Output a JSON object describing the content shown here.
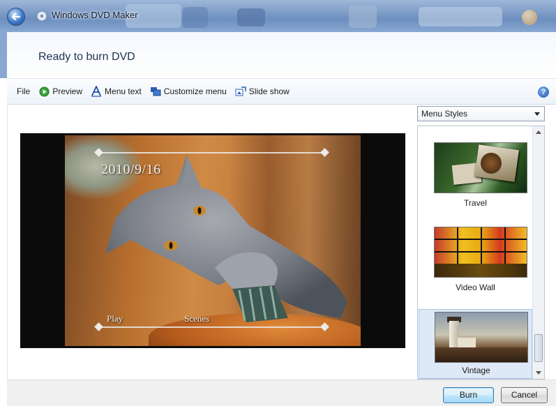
{
  "window": {
    "title": "Windows DVD Maker",
    "back_icon": "back-arrow-icon",
    "app_icon": "dvd-maker-icon"
  },
  "header": {
    "title": "Ready to burn DVD"
  },
  "toolbar": {
    "items": [
      {
        "label": "File",
        "icon": ""
      },
      {
        "label": "Preview",
        "icon": "play-icon"
      },
      {
        "label": "Menu text",
        "icon": "text-a-icon"
      },
      {
        "label": "Customize menu",
        "icon": "customize-icon"
      },
      {
        "label": "Slide show",
        "icon": "slideshow-icon"
      }
    ],
    "help_label": "?"
  },
  "preview": {
    "date_text": "2010/9/16",
    "menu_items": [
      "Play",
      "Scenes"
    ]
  },
  "styles_panel": {
    "dropdown_value": "Menu Styles",
    "styles": [
      {
        "label": "Travel",
        "selected": false
      },
      {
        "label": "Video Wall",
        "selected": false
      },
      {
        "label": "Vintage",
        "selected": true
      }
    ]
  },
  "footer": {
    "burn_label": "Burn",
    "cancel_label": "Cancel"
  },
  "colors": {
    "accent": "#3c7fb1",
    "selection": "#dde9f7",
    "header_text": "#1e3250"
  }
}
